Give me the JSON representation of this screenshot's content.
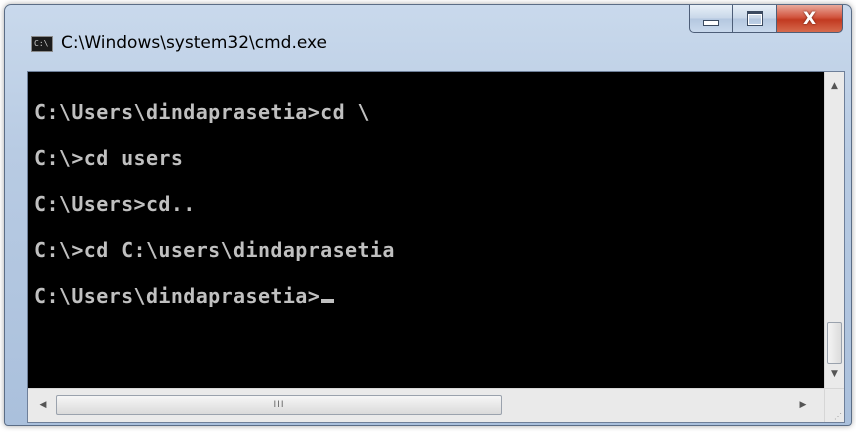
{
  "window": {
    "title": "C:\\Windows\\system32\\cmd.exe",
    "icon_label": "C:\\",
    "icon": "console-icon"
  },
  "caption": {
    "minimize_icon": "minimize-icon",
    "maximize_icon": "maximize-icon",
    "close_glyph": "X"
  },
  "console": {
    "lines": [
      "C:\\Users\\dindaprasetia>cd \\",
      "C:\\>cd users",
      "C:\\Users>cd..",
      "C:\\>cd C:\\users\\dindaprasetia",
      "C:\\Users\\dindaprasetia>"
    ],
    "text_color": "#c0c0c0",
    "background": "#000000"
  },
  "scrollbars": {
    "up_arrow": "▲",
    "down_arrow": "▼",
    "left_arrow": "◀",
    "right_arrow": "▶",
    "grip": "III"
  }
}
